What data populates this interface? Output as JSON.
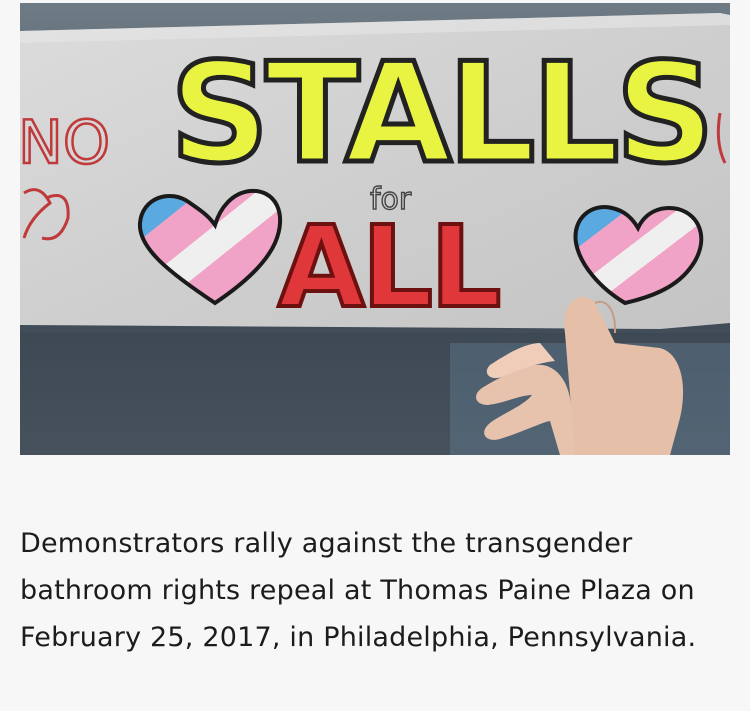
{
  "photo": {
    "sign": {
      "line1": "STALLS",
      "line2_small": "for",
      "line3": "ALL",
      "left_edge_text": "NO"
    }
  },
  "caption": {
    "text": "Demonstrators rally against the transgender bathroom rights repeal at Thomas Paine Plaza on February 25, 2017, in Philadelphia, Pennsylvania."
  }
}
